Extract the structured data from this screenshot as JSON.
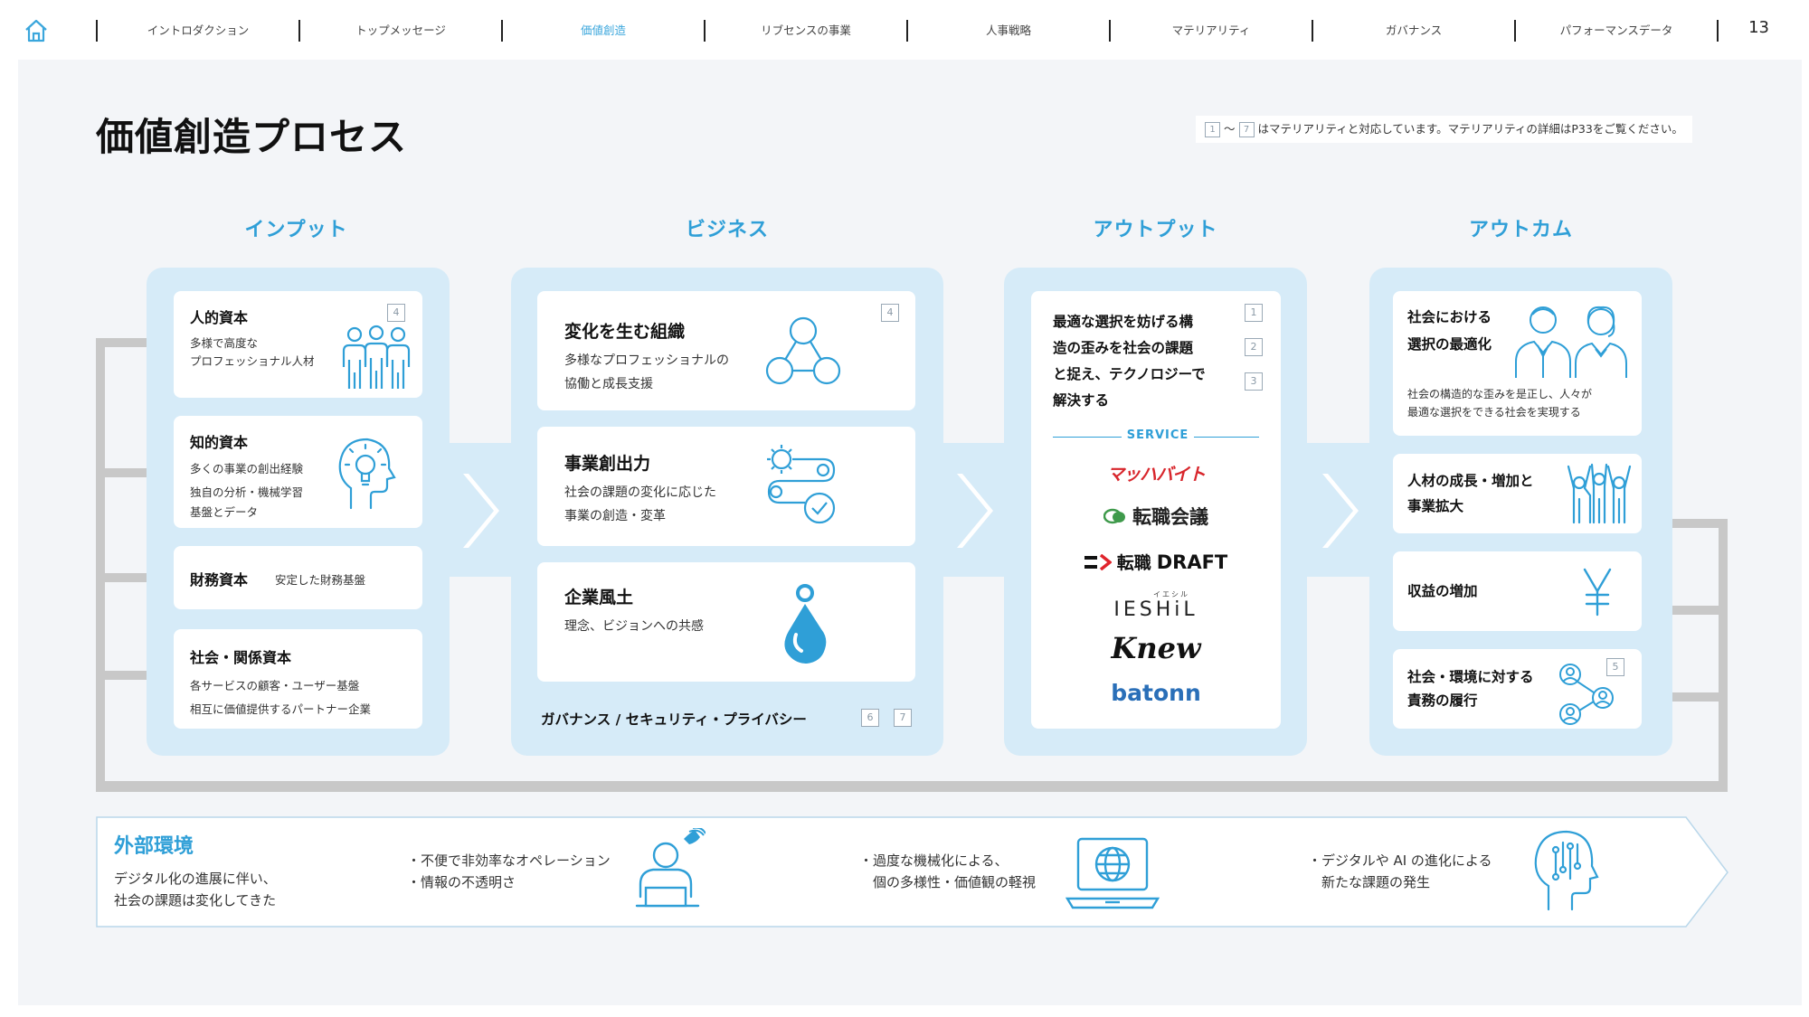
{
  "nav": {
    "tabs": [
      "イントロダクション",
      "トップメッセージ",
      "価値創造",
      "リブセンスの事業",
      "人事戦略",
      "マテリアリティ",
      "ガバナンス",
      "パフォーマンスデータ"
    ],
    "active_index": 2,
    "page_number": "13"
  },
  "title": "価値創造プロセス",
  "legend": {
    "from_badge": "1",
    "tilde": "〜",
    "to_badge": "7",
    "text": "はマテリアリティと対応しています。マテリアリティの詳細はP33をご覧ください。"
  },
  "columns": {
    "input": "インプット",
    "business": "ビジネス",
    "output": "アウトプット",
    "outcome": "アウトカム"
  },
  "input": {
    "human": {
      "title": "人的資本",
      "lines": [
        "多様で高度な",
        "プロフェッショナル人材"
      ],
      "badge": "4",
      "icon": "people-icon"
    },
    "intellectual": {
      "title": "知的資本",
      "lines": [
        "多くの事業の創出経験",
        "独自の分析・機械学習",
        "基盤とデータ"
      ],
      "icon": "idea-head-icon"
    },
    "financial": {
      "title": "財務資本",
      "text": "安定した財務基盤"
    },
    "social": {
      "title": "社会・関係資本",
      "lines": [
        "各サービスの顧客・ユーザー基盤",
        "相互に価値提供するパートナー企業"
      ]
    }
  },
  "business": {
    "org": {
      "title": "変化を生む組織",
      "lines": [
        "多様なプロフェッショナルの",
        "協働と成長支援"
      ],
      "badge": "4",
      "icon": "network-icon"
    },
    "creation": {
      "title": "事業創出力",
      "lines": [
        "社会の課題の変化に応じた",
        "事業の創造・変革"
      ],
      "icon": "process-gear-icon"
    },
    "culture": {
      "title": "企業風土",
      "lines": [
        "理念、ビジョンへの共感"
      ],
      "icon": "drop-icon"
    },
    "governance": {
      "text": "ガバナンス / セキュリティ・プライバシー",
      "badges": [
        "6",
        "7"
      ]
    }
  },
  "output": {
    "lines": [
      "最適な選択を妨げる構",
      "造の歪みを社会の課題",
      "と捉え、テクノロジーで",
      "解決する"
    ],
    "badges": [
      "1",
      "2",
      "3"
    ],
    "service_label": "SERVICE",
    "logos": {
      "machbaito": "マッハバイト",
      "tenshoku_kaigi": "転職会議",
      "draft_mark": "転職",
      "draft_word": "DRAFT",
      "ieshil_ruby": "イエシル",
      "ieshil": "IESHiL",
      "knew": "Knew",
      "batonn": "batonn"
    }
  },
  "outcome": {
    "society": {
      "title_lines": [
        "社会における",
        "選択の最適化"
      ],
      "lines": [
        "社会の構造的な歪みを是正し、人々が",
        "最適な選択をできる社会を実現する"
      ],
      "icon": "people-pair-icon"
    },
    "growth": {
      "title_lines": [
        "人材の成長・増加と",
        "事業拡大"
      ],
      "icon": "team-cheer-icon"
    },
    "profit": {
      "title": "収益の増加",
      "icon": "yen-icon"
    },
    "responsibility": {
      "title_lines": [
        "社会・環境に対する",
        "責務の履行"
      ],
      "badge": "5",
      "icon": "connected-people-icon"
    }
  },
  "environment": {
    "title": "外部環境",
    "lines": [
      "デジタル化の進展に伴い、",
      "社会の課題は変化してきた"
    ],
    "items": [
      {
        "lines": [
          "・不便で非効率なオペレーション",
          "・情報の不透明さ"
        ],
        "icon": "worker-laptop-icon"
      },
      {
        "lines": [
          "・過度な機械化による、",
          "　個の多様性・価値観の軽視"
        ],
        "icon": "laptop-globe-icon"
      },
      {
        "lines": [
          "・デジタルや AI の進化による",
          "　新たな課題の発生"
        ],
        "icon": "ai-head-icon"
      }
    ]
  },
  "colors": {
    "accent": "#2f9fd7",
    "panel_bg": "#d6ebf8",
    "loop_gray": "#c8c8c8",
    "machbaito_red": "#d8262c",
    "kaigi_green": "#3f9a4b",
    "batonn_blue": "#2a6fb8"
  }
}
